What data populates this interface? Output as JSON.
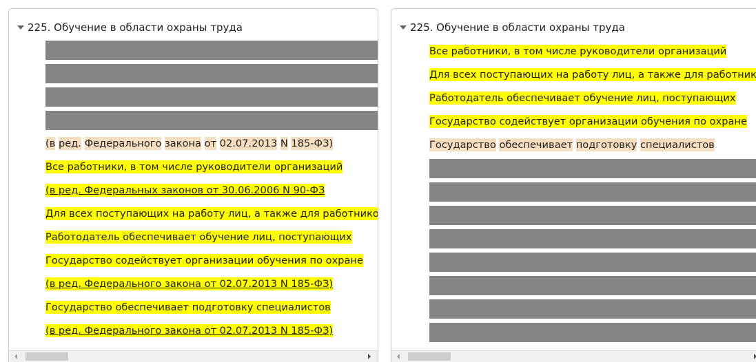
{
  "left_panel": {
    "title": "225. Обучение в области охраны труда",
    "rows": [
      {
        "style": "gray",
        "text": ""
      },
      {
        "style": "gray",
        "text": ""
      },
      {
        "style": "gray",
        "text": ""
      },
      {
        "style": "gray",
        "text": ""
      },
      {
        "style": "tan",
        "text": "(в ред. Федерального закона от 02.07.2013 N 185-ФЗ)"
      },
      {
        "style": "yellow",
        "text": "Все работники, в том числе руководители организаций"
      },
      {
        "style": "yellow under",
        "text": "(в ред. Федеральных законов от 30.06.2006 N 90-ФЗ"
      },
      {
        "style": "yellow",
        "text": "Для всех поступающих на работу лиц, а также для работников"
      },
      {
        "style": "yellow",
        "text": "Работодатель обеспечивает обучение лиц, поступающих"
      },
      {
        "style": "yellow",
        "text": "Государство содействует организации обучения по охране"
      },
      {
        "style": "yellow under",
        "text": "(в ред. Федерального закона от 02.07.2013 N 185-ФЗ)"
      },
      {
        "style": "yellow",
        "text": "Государство обеспечивает подготовку специалистов"
      },
      {
        "style": "yellow under",
        "text": "(в ред. Федерального закона от 02.07.2013 N 185-ФЗ)"
      }
    ]
  },
  "right_panel": {
    "title": "225. Обучение в области охраны труда",
    "rows": [
      {
        "style": "yellow",
        "text": "Все работники, в том числе руководители организаций"
      },
      {
        "style": "yellow",
        "text": "Для всех поступающих на работу лиц, а также для работников"
      },
      {
        "style": "yellow",
        "text": "Работодатель обеспечивает обучение лиц, поступающих"
      },
      {
        "style": "yellow",
        "text": "Государство содействует организации обучения по охране"
      },
      {
        "style": "tan",
        "text": "Государство обеспечивает подготовку специалистов"
      },
      {
        "style": "gray",
        "text": ""
      },
      {
        "style": "gray",
        "text": ""
      },
      {
        "style": "gray",
        "text": ""
      },
      {
        "style": "gray",
        "text": ""
      },
      {
        "style": "gray",
        "text": ""
      },
      {
        "style": "gray",
        "text": ""
      },
      {
        "style": "gray",
        "text": ""
      },
      {
        "style": "gray",
        "text": ""
      }
    ]
  },
  "icons": {
    "expand": "triangle-down-icon",
    "scroll_left": "arrow-left-icon",
    "scroll_right": "arrow-right-icon"
  },
  "colors": {
    "highlight_yellow": "#ffff00",
    "highlight_tan": "#f6dfc0",
    "redacted_gray": "#858585"
  }
}
